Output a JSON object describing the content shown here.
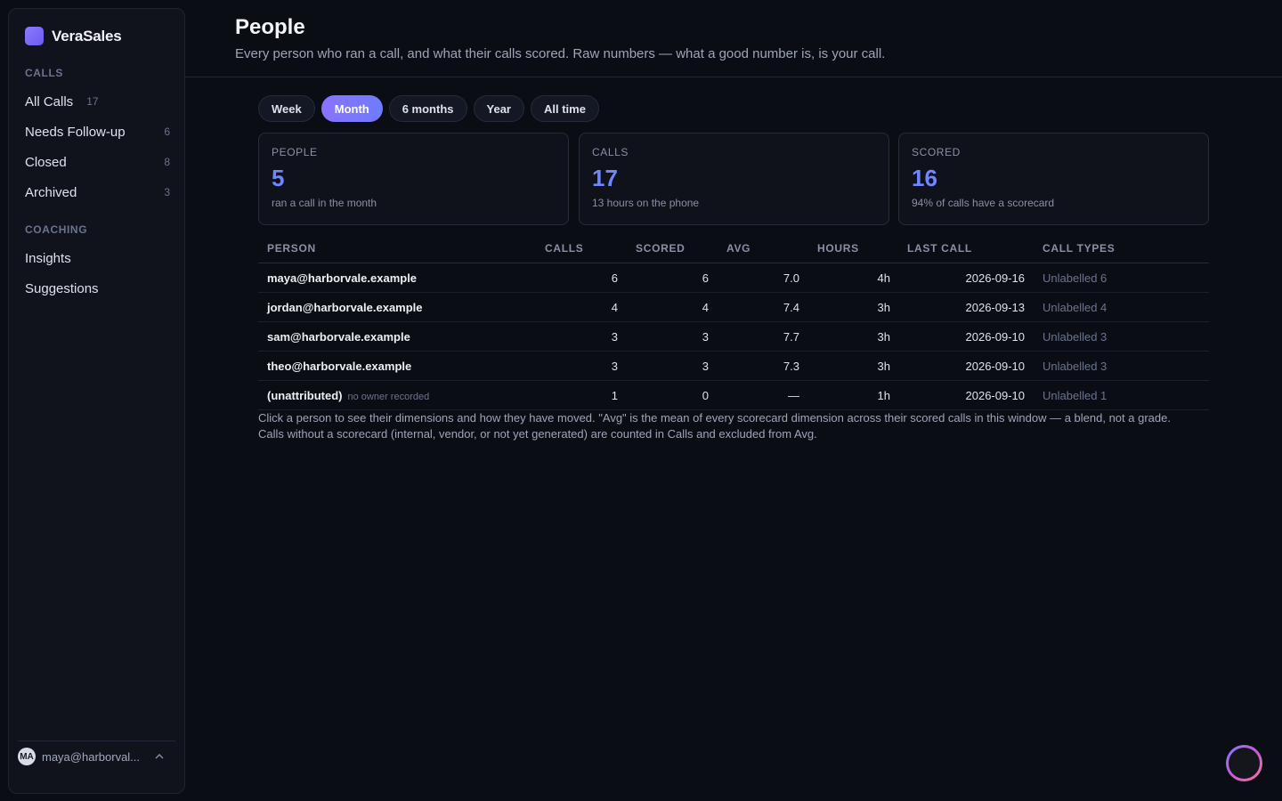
{
  "app": {
    "name": "VeraSales"
  },
  "sidebar": {
    "calls_section": "CALLS",
    "calls": [
      {
        "label": "All Calls",
        "count": "17"
      },
      {
        "label": "Needs Follow-up",
        "count": "6"
      },
      {
        "label": "Closed",
        "count": "8"
      },
      {
        "label": "Archived",
        "count": "3"
      }
    ],
    "coaching_section": "COACHING",
    "coaching": [
      {
        "label": "Insights"
      },
      {
        "label": "Suggestions"
      }
    ],
    "user": {
      "initials": "MA",
      "email": "maya@harborval..."
    }
  },
  "header": {
    "title": "People",
    "subtitle": "Every person who ran a call, and what their calls scored. Raw numbers — what a good number is, is your call."
  },
  "tabs": [
    "Week",
    "Month",
    "6 months",
    "Year",
    "All time"
  ],
  "active_tab": "Month",
  "stats": [
    {
      "label": "PEOPLE",
      "value": "5",
      "sub": "ran a call in the month"
    },
    {
      "label": "CALLS",
      "value": "17",
      "sub": "13 hours on the phone"
    },
    {
      "label": "SCORED",
      "value": "16",
      "sub": "94% of calls have a scorecard"
    }
  ],
  "table": {
    "columns": {
      "person": "PERSON",
      "calls": "CALLS",
      "scored": "SCORED",
      "avg": "AVG",
      "hours": "HOURS",
      "last_call": "LAST CALL",
      "call_types": "CALL TYPES"
    },
    "rows": [
      {
        "person": "maya@harborvale.example",
        "note": "",
        "calls": "6",
        "scored": "6",
        "avg": "7.0",
        "hours": "4h",
        "last_call": "2026-09-16",
        "call_types": "Unlabelled 6"
      },
      {
        "person": "jordan@harborvale.example",
        "note": "",
        "calls": "4",
        "scored": "4",
        "avg": "7.4",
        "hours": "3h",
        "last_call": "2026-09-13",
        "call_types": "Unlabelled 4"
      },
      {
        "person": "sam@harborvale.example",
        "note": "",
        "calls": "3",
        "scored": "3",
        "avg": "7.7",
        "hours": "3h",
        "last_call": "2026-09-10",
        "call_types": "Unlabelled 3"
      },
      {
        "person": "theo@harborvale.example",
        "note": "",
        "calls": "3",
        "scored": "3",
        "avg": "7.3",
        "hours": "3h",
        "last_call": "2026-09-10",
        "call_types": "Unlabelled 3"
      },
      {
        "person": "(unattributed)",
        "note": "no owner recorded",
        "calls": "1",
        "scored": "0",
        "avg": "—",
        "hours": "1h",
        "last_call": "2026-09-10",
        "call_types": "Unlabelled 1"
      }
    ]
  },
  "footnote": "Click a person to see their dimensions and how they have moved. \"Avg\" is the mean of every scorecard dimension across their scored calls in this window — a blend, not a grade. Calls without a scorecard (internal, vendor, or not yet generated) are counted in Calls and excluded from Avg.",
  "colors": {
    "accent": "#6f86ff",
    "background": "#0b0d14",
    "active_tab": "#8a72ff"
  }
}
